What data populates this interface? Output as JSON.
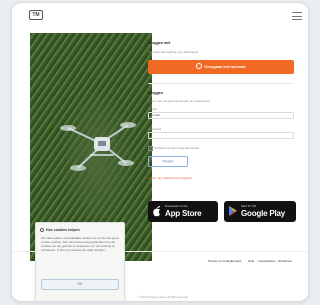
{
  "header": {
    "logo_text": "TM",
    "menu_icon": "hamburger-icon"
  },
  "hero": {
    "alt": "drone-over-vineyard-photo"
  },
  "login": {
    "section_title": "Inloggen met",
    "section_subtitle": "De enige aanmelding voor Sharepoint",
    "primary_button": "Doorgaan met account",
    "alt_title": "Inloggen",
    "alt_subtitle": "Log in met uw gebruikersnaam en wachtwoord",
    "email_label": "E-mail",
    "email_value": "E-mail",
    "password_label": "Password",
    "password_value": "",
    "remember_label": "Onthoud mij voor volgende sessie",
    "login_button": "Inloggen",
    "forgot_link": "Ik ben mijn wachtwoord vergeten"
  },
  "stores": {
    "apple": {
      "line1": "Download on the",
      "line2": "App Store"
    },
    "google": {
      "line1": "GET IT ON",
      "line2": "Google Play"
    }
  },
  "footer": {
    "links": [
      "Privacy & Cookies",
      "Contact",
      "Help",
      "Voorwaarden",
      "Disclaimer"
    ],
    "copyright": "© 2023 Company Name. All rights reserved."
  },
  "cookie": {
    "title": "Hoe cookies helpen",
    "body": "We slaan alleen noodzakelijke cookies op om de site goed te laten werken. Met uw toestemming gebruiken we ook cookies om het gebruik te analyseren en uw ervaring te verbeteren. U kunt uw voorkeuren altijd wijzigen.",
    "button": "OK"
  }
}
